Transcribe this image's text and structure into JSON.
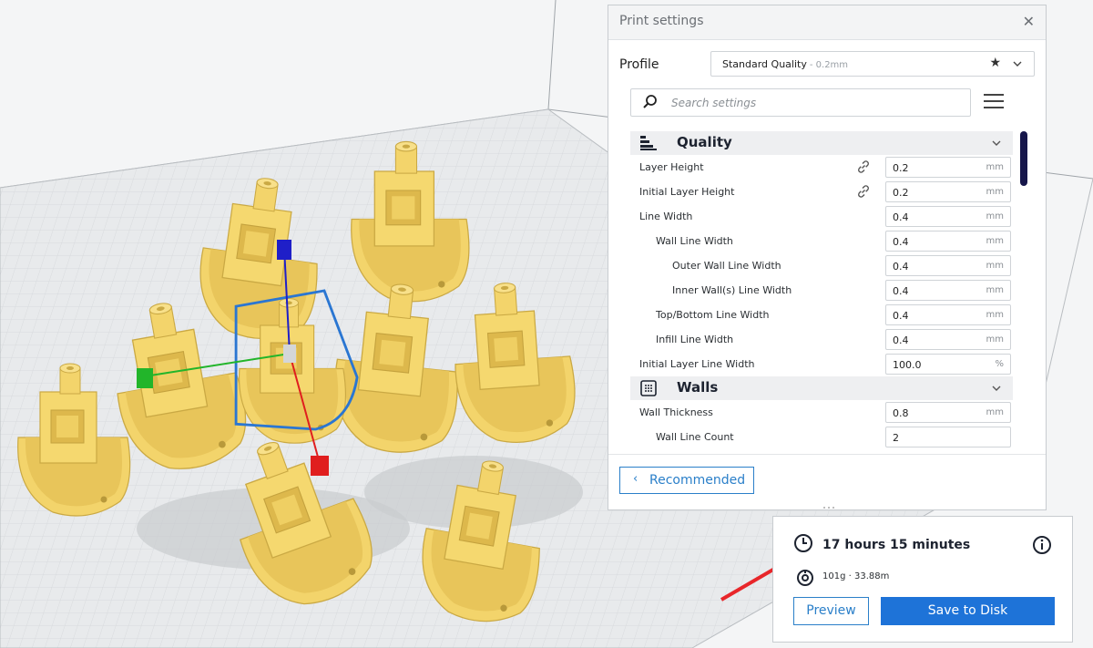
{
  "panel": {
    "title": "Print settings",
    "profile_label": "Profile",
    "profile_value": "Standard Quality",
    "profile_sub": "- 0.2mm",
    "search_placeholder": "Search settings",
    "recommended_label": "Recommended",
    "categories": [
      {
        "label": "Quality",
        "icon": "quality-icon",
        "settings": [
          {
            "label": "Layer Height",
            "value": "0.2",
            "unit": "mm",
            "linked": true,
            "indent": 0
          },
          {
            "label": "Initial Layer Height",
            "value": "0.2",
            "unit": "mm",
            "linked": true,
            "indent": 0
          },
          {
            "label": "Line Width",
            "value": "0.4",
            "unit": "mm",
            "linked": false,
            "indent": 0
          },
          {
            "label": "Wall Line Width",
            "value": "0.4",
            "unit": "mm",
            "linked": false,
            "indent": 1
          },
          {
            "label": "Outer Wall Line Width",
            "value": "0.4",
            "unit": "mm",
            "linked": false,
            "indent": 2
          },
          {
            "label": "Inner Wall(s) Line Width",
            "value": "0.4",
            "unit": "mm",
            "linked": false,
            "indent": 2
          },
          {
            "label": "Top/Bottom Line Width",
            "value": "0.4",
            "unit": "mm",
            "linked": false,
            "indent": 1
          },
          {
            "label": "Infill Line Width",
            "value": "0.4",
            "unit": "mm",
            "linked": false,
            "indent": 1
          },
          {
            "label": "Initial Layer Line Width",
            "value": "100.0",
            "unit": "%",
            "linked": false,
            "indent": 0
          }
        ]
      },
      {
        "label": "Walls",
        "icon": "walls-icon",
        "settings": [
          {
            "label": "Wall Thickness",
            "value": "0.8",
            "unit": "mm",
            "linked": false,
            "indent": 0
          },
          {
            "label": "Wall Line Count",
            "value": "2",
            "unit": "",
            "linked": false,
            "indent": 1
          }
        ]
      }
    ]
  },
  "info": {
    "time": "17 hours 15 minutes",
    "material": "101g · 33.88m",
    "preview_label": "Preview",
    "save_label": "Save to Disk"
  },
  "colors": {
    "accent": "#1e73d8",
    "model": "#f3d46b",
    "model_shadow": "#c9b04a",
    "selection": "#2a76d2",
    "axis_x": "#e01e1e",
    "axis_y": "#22b52a",
    "axis_z": "#1f1fc8",
    "arrow": "#e8262a"
  }
}
